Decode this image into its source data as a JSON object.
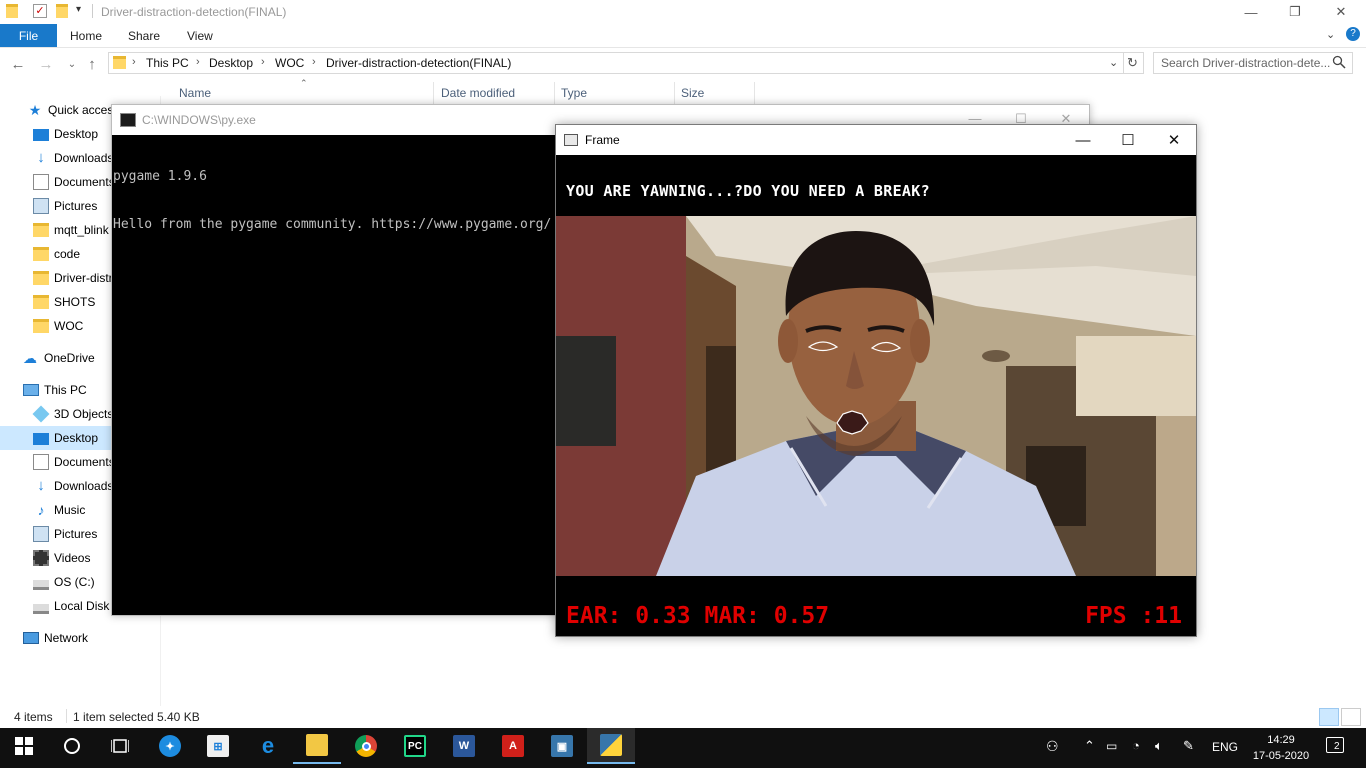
{
  "explorer": {
    "title": "Driver-distraction-detection(FINAL)",
    "tabs": {
      "file": "File",
      "home": "Home",
      "share": "Share",
      "view": "View"
    },
    "breadcrumb": [
      "This PC",
      "Desktop",
      "WOC",
      "Driver-distraction-detection(FINAL)"
    ],
    "search_placeholder": "Search Driver-distraction-dete...",
    "columns": {
      "name": "Name",
      "date": "Date modified",
      "type": "Type",
      "size": "Size"
    },
    "nav": {
      "quick_access": "Quick access",
      "qa_items": [
        "Desktop",
        "Downloads",
        "Documents",
        "Pictures",
        "mqtt_blink",
        "code",
        "Driver-distr",
        "SHOTS",
        "WOC"
      ],
      "onedrive": "OneDrive",
      "this_pc": "This PC",
      "pc_items": [
        "3D Objects",
        "Desktop",
        "Documents",
        "Downloads",
        "Music",
        "Pictures",
        "Videos",
        "OS (C:)",
        "Local Disk ("
      ],
      "network": "Network"
    },
    "status": {
      "items": "4 items",
      "selected": "1 item selected",
      "size": "5.40 KB"
    }
  },
  "console": {
    "title": "C:\\WINDOWS\\py.exe",
    "lines": [
      "pygame 1.9.6",
      "Hello from the pygame community. https://www.pygame.org/"
    ]
  },
  "frame": {
    "title": "Frame",
    "alert": "YOU ARE YAWNING...?DO YOU NEED A BREAK?",
    "metrics": "EAR: 0.33 MAR: 0.57",
    "fps": "FPS :11",
    "text_color": "#e00000"
  },
  "taskbar": {
    "lang": "ENG",
    "time": "14:29",
    "date": "17-05-2020",
    "notifications": "2"
  }
}
